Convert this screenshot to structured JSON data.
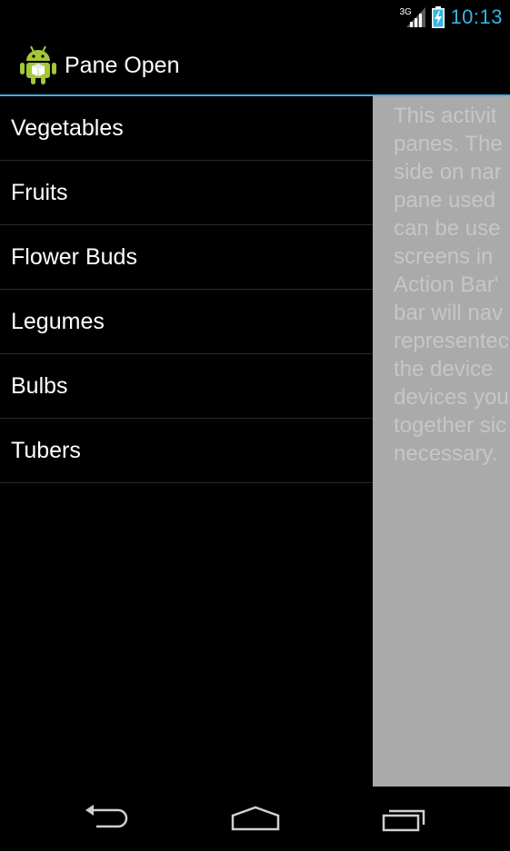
{
  "status_bar": {
    "network_type": "3G",
    "time": "10:13",
    "icons": [
      "signal-icon",
      "battery-charging-icon"
    ]
  },
  "action_bar": {
    "title": "Pane Open",
    "icon": "android-app-icon"
  },
  "nav_list": {
    "items": [
      {
        "label": "Vegetables"
      },
      {
        "label": "Fruits"
      },
      {
        "label": "Flower Buds"
      },
      {
        "label": "Legumes"
      },
      {
        "label": "Bulbs"
      },
      {
        "label": "Tubers"
      }
    ]
  },
  "content": {
    "lines": [
      "This activit",
      "panes. The",
      "side on nar",
      "pane used",
      "can be use",
      "screens in",
      "Action Bar'",
      "bar will nav",
      "representec",
      "the device",
      "devices you",
      "together sic",
      "necessary."
    ]
  },
  "system_nav": {
    "icons": [
      "back-icon",
      "home-icon",
      "recents-icon"
    ]
  },
  "colors": {
    "accent": "#33b5e5",
    "pane_bg": "#aaaaaa",
    "pane_text": "#c6c6c6",
    "background": "#000000"
  }
}
